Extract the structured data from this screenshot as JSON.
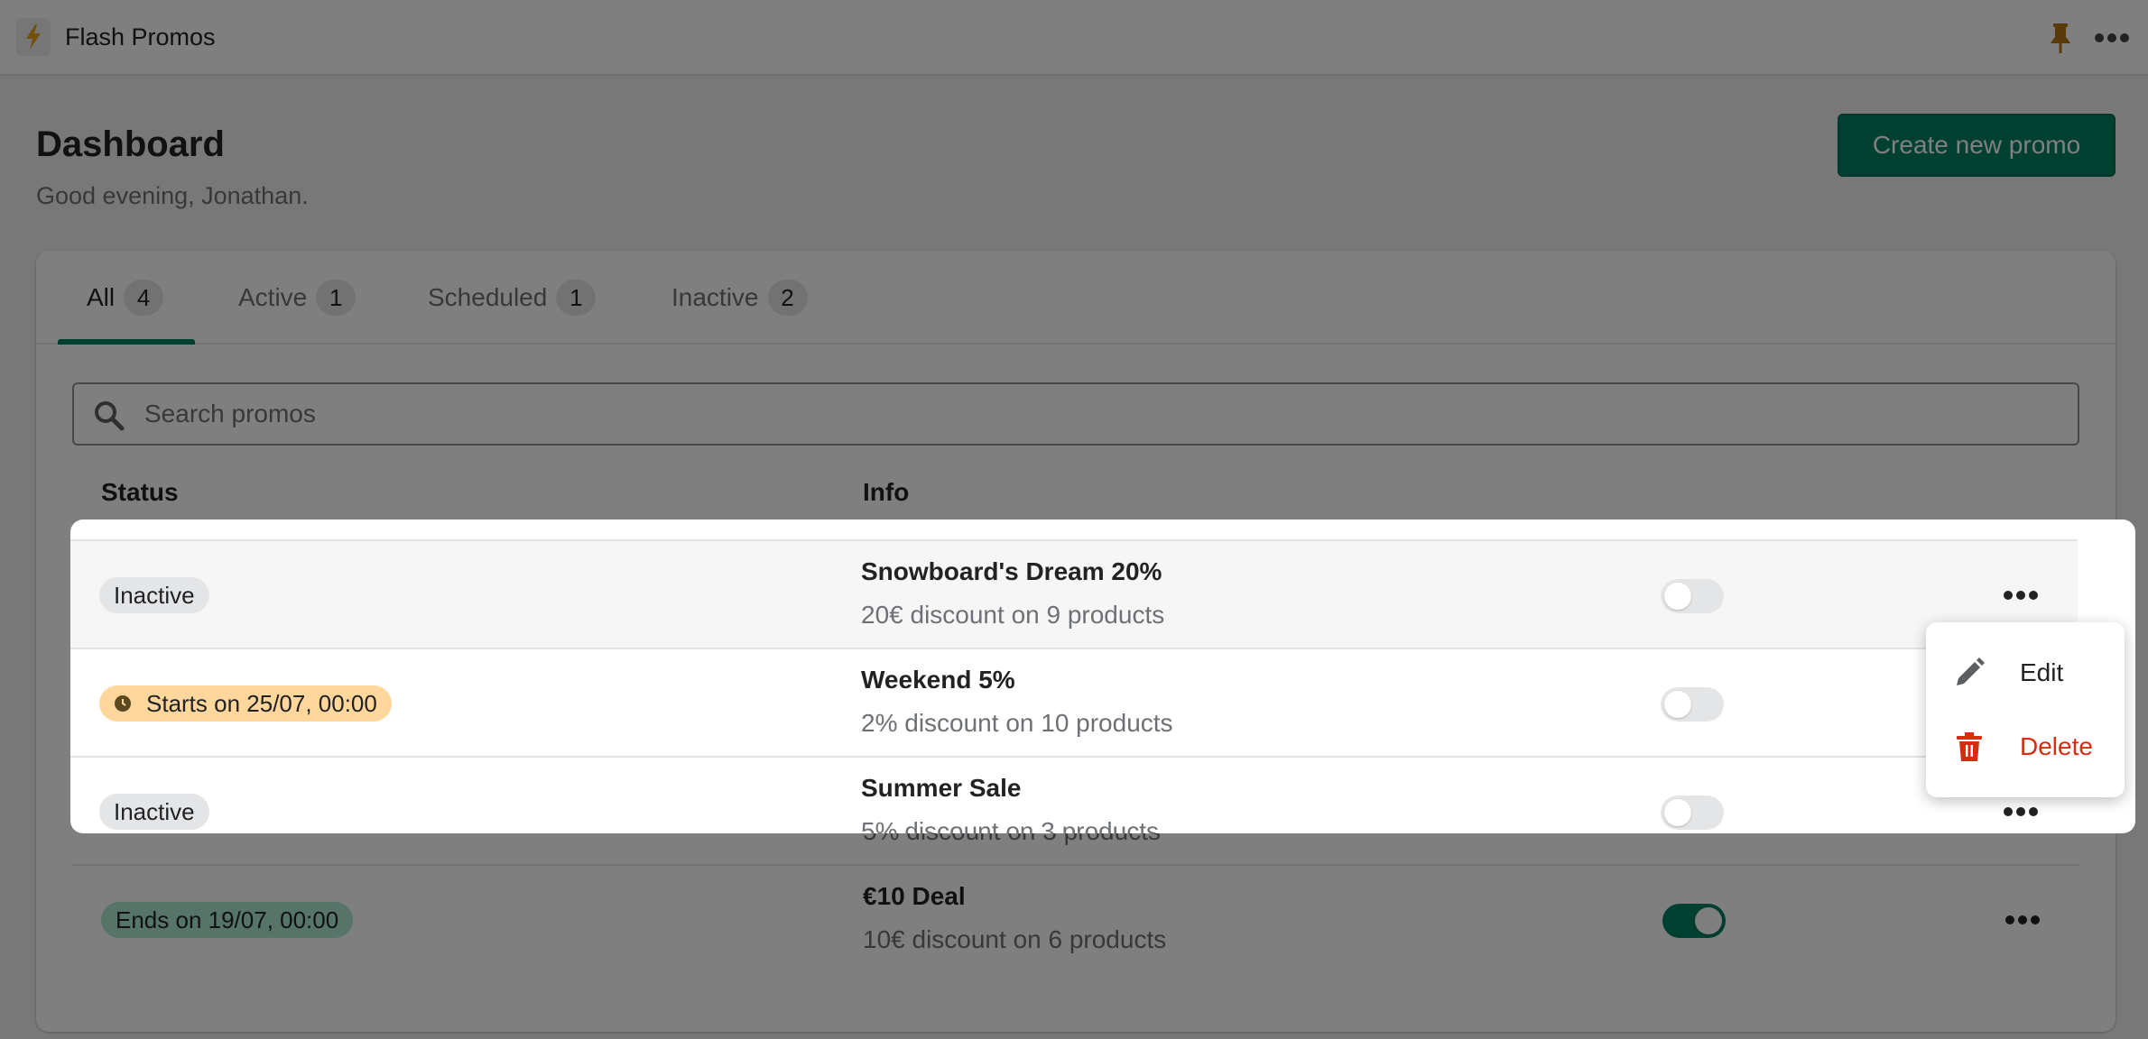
{
  "app": {
    "title": "Flash Promos",
    "icon": "lightning-bolt-icon"
  },
  "topbar": {
    "pin_icon": "pin-icon",
    "more_icon": "more-horizontal-icon"
  },
  "header": {
    "title": "Dashboard",
    "subtitle": "Good evening, Jonathan.",
    "create_label": "Create new promo"
  },
  "tabs": [
    {
      "label": "All",
      "count": "4",
      "selected": true
    },
    {
      "label": "Active",
      "count": "1",
      "selected": false
    },
    {
      "label": "Scheduled",
      "count": "1",
      "selected": false
    },
    {
      "label": "Inactive",
      "count": "2",
      "selected": false
    }
  ],
  "search": {
    "placeholder": "Search promos",
    "value": ""
  },
  "table": {
    "headers": {
      "status": "Status",
      "info": "Info"
    },
    "rows": [
      {
        "status": "Inactive",
        "status_kind": "inactive",
        "name": "Snowboard's Dream 20%",
        "description": "20€ discount on 9 products",
        "enabled": false
      },
      {
        "status": "Starts on 25/07, 00:00",
        "status_kind": "scheduled",
        "name": "Weekend 5%",
        "description": "2% discount on 10 products",
        "enabled": false
      },
      {
        "status": "Inactive",
        "status_kind": "inactive",
        "name": "Summer Sale",
        "description": "5% discount on 3 products",
        "enabled": false
      },
      {
        "status": "Ends on 19/07, 00:00",
        "status_kind": "active",
        "name": "€10 Deal",
        "description": "10€ discount on 6 products",
        "enabled": true
      }
    ]
  },
  "row_menu": {
    "items": [
      {
        "label": "Edit",
        "icon": "pencil-icon"
      },
      {
        "label": "Delete",
        "icon": "trash-icon",
        "color": "#d72c0d"
      }
    ]
  },
  "colors": {
    "primary": "#008060",
    "danger": "#d72c0d",
    "scheduled_badge": "#ffd79d",
    "active_badge": "#aee9d1",
    "brand_icon": "#e8a317"
  }
}
